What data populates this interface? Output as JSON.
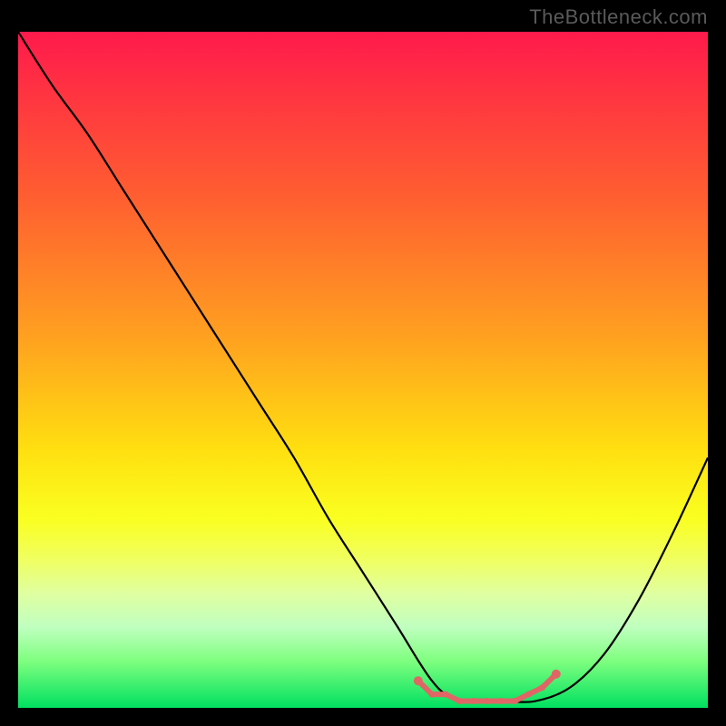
{
  "watermark": "TheBottleneck.com",
  "chart_data": {
    "type": "line",
    "title": "",
    "xlabel": "",
    "ylabel": "",
    "xlim": [
      0,
      100
    ],
    "ylim": [
      0,
      100
    ],
    "series": [
      {
        "name": "bottleneck-curve",
        "x": [
          0,
          5,
          10,
          15,
          20,
          25,
          30,
          35,
          40,
          45,
          50,
          55,
          58,
          60,
          62,
          65,
          70,
          75,
          80,
          85,
          90,
          95,
          100
        ],
        "y": [
          100,
          92,
          85,
          77,
          69,
          61,
          53,
          45,
          37,
          28,
          20,
          12,
          7,
          4,
          2,
          1,
          1,
          1,
          3,
          8,
          16,
          26,
          37
        ]
      }
    ],
    "markers": {
      "name": "optimal-range",
      "x": [
        58,
        60,
        62,
        64,
        66,
        68,
        70,
        72,
        74,
        76,
        78
      ],
      "y": [
        4,
        2,
        2,
        1,
        1,
        1,
        1,
        1,
        2,
        3,
        5
      ],
      "color": "#e06666"
    }
  },
  "colors": {
    "background": "#000000",
    "curve": "#000000",
    "marker": "#e06666"
  }
}
